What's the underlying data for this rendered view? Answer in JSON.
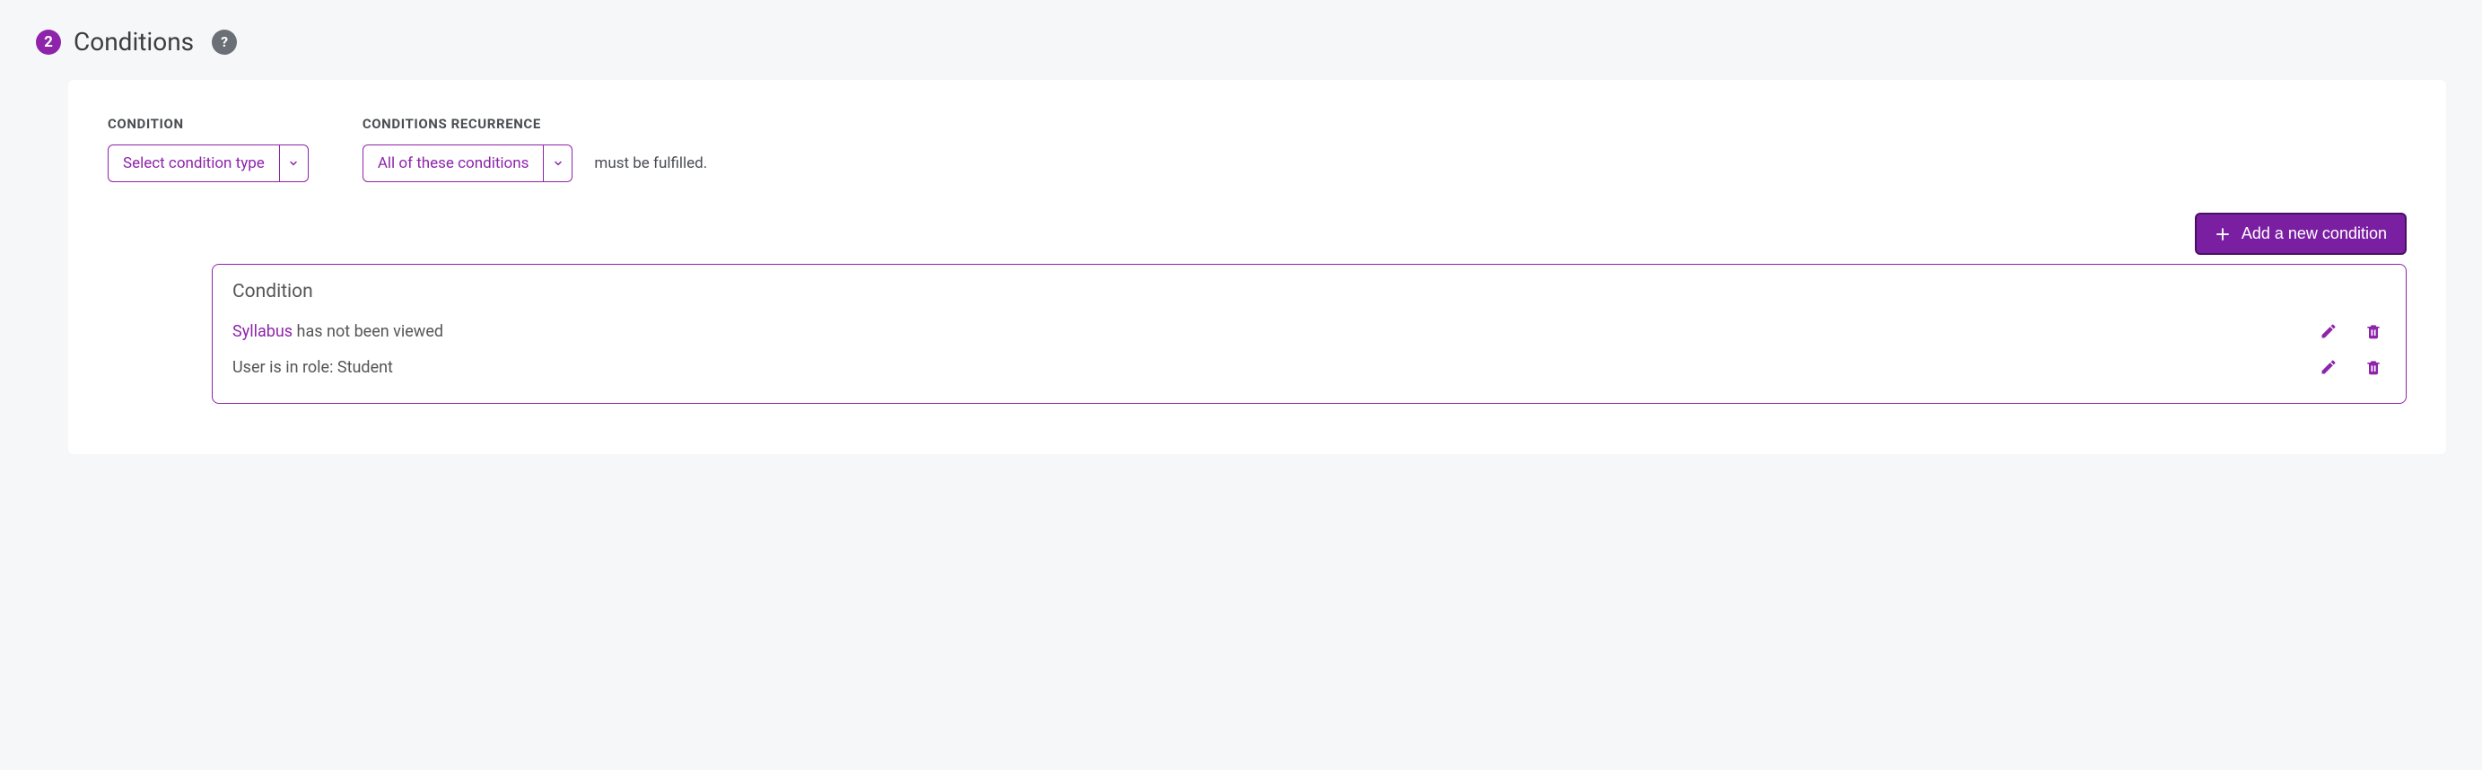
{
  "section": {
    "step": "2",
    "title": "Conditions",
    "help": "?"
  },
  "labels": {
    "condition": "CONDITION",
    "recurrence": "CONDITIONS RECURRENCE",
    "recurrence_suffix": "must be fulfilled.",
    "condition_box_title": "Condition"
  },
  "selects": {
    "condition_type": "Select condition type",
    "recurrence": "All of these conditions"
  },
  "buttons": {
    "add": "Add a new condition"
  },
  "conditions": [
    {
      "prefix": "Syllabus",
      "rest": " has not been viewed",
      "has_highlight": true
    },
    {
      "prefix": "",
      "rest": "User is in role: Student",
      "has_highlight": false
    }
  ],
  "colors": {
    "accent": "#8e24aa",
    "accent_dark": "#7b1fa2"
  }
}
